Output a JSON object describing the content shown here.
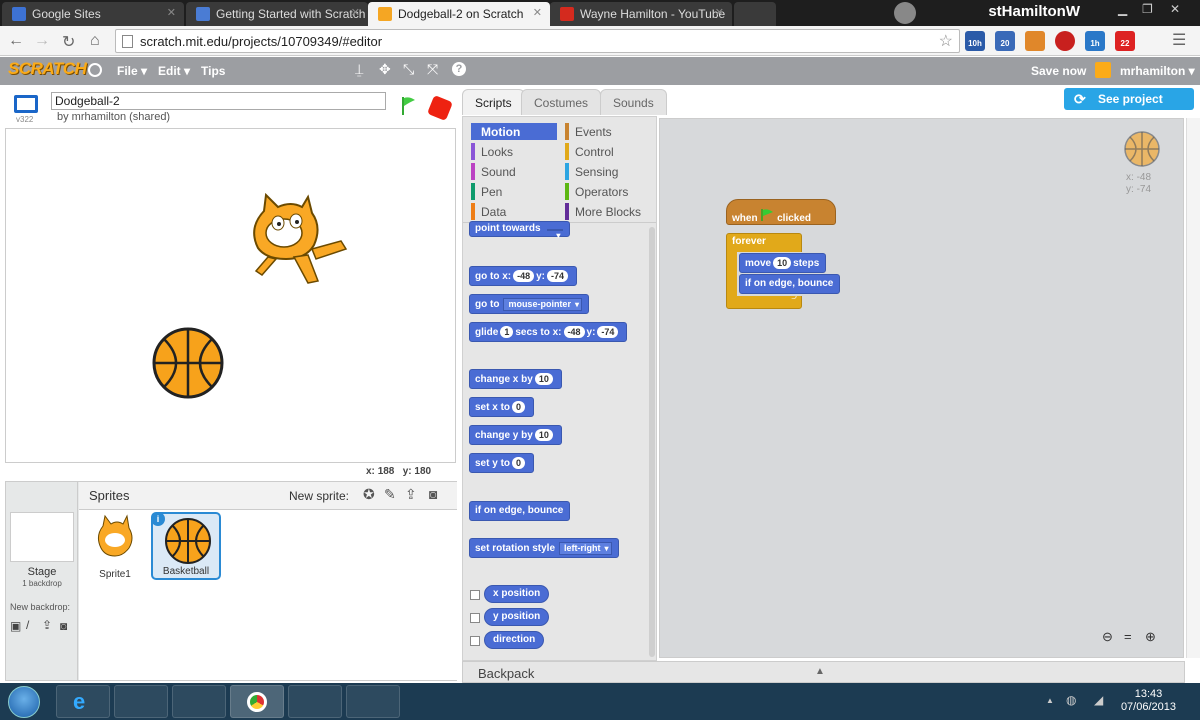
{
  "browser": {
    "tabs": [
      {
        "title": "Google Sites",
        "icon_color": "#3d72d4"
      },
      {
        "title": "Getting Started with Scratch",
        "icon_color": "#4a7cd4"
      },
      {
        "title": "Dodgeball-2 on Scratch",
        "icon_color": "#f5a623",
        "active": true
      },
      {
        "title": "Wayne Hamilton - YouTube",
        "icon_color": "#d42a1e"
      }
    ],
    "profile_name": "stHamiltonW",
    "url": "scratch.mit.edu/projects/10709349/#editor",
    "extensions": [
      "10h",
      "20",
      "",
      "",
      "1h",
      "22",
      ""
    ]
  },
  "scratch": {
    "logo": "SCRATCH",
    "menus": {
      "file": "File ▾",
      "edit": "Edit ▾",
      "tips": "Tips"
    },
    "save_now": "Save now",
    "username": "mrhamilton ▾",
    "project_title": "Dodgeball-2",
    "author": "by mrhamilton (shared)",
    "version": "v322",
    "stage_coords": {
      "x_label": "x:",
      "x": "188",
      "y_label": "y:",
      "y": "180"
    },
    "tabs": {
      "scripts": "Scripts",
      "costumes": "Costumes",
      "sounds": "Sounds"
    },
    "see_project_page": "See project page",
    "sprites_heading": "Sprites",
    "new_sprite": "New sprite:",
    "stage_label": "Stage",
    "backdrop_count": "1 backdrop",
    "new_backdrop": "New backdrop:",
    "sprites": [
      {
        "name": "Sprite1"
      },
      {
        "name": "Basketball",
        "selected": true
      }
    ],
    "categories_left": [
      {
        "label": "Motion",
        "color": "#4a6cd4"
      },
      {
        "label": "Looks",
        "color": "#8a55d7"
      },
      {
        "label": "Sound",
        "color": "#bb42c3"
      },
      {
        "label": "Pen",
        "color": "#0e9a6c"
      },
      {
        "label": "Data",
        "color": "#ee7d16"
      }
    ],
    "categories_right": [
      {
        "label": "Events",
        "color": "#c88330"
      },
      {
        "label": "Control",
        "color": "#e1a91a"
      },
      {
        "label": "Sensing",
        "color": "#2ca5e2"
      },
      {
        "label": "Operators",
        "color": "#5cb712"
      },
      {
        "label": "More Blocks",
        "color": "#632d99"
      }
    ],
    "blocks": {
      "point_towards": "point towards",
      "goto_xy": "go to x:",
      "goto_x": "-48",
      "goto_y_label": "y:",
      "goto_y": "-74",
      "goto": "go to",
      "goto_target": "mouse-pointer",
      "glide": "glide",
      "glide_secs": "1",
      "glide_mid": "secs to x:",
      "glide_x": "-48",
      "glide_y_label": "y:",
      "glide_y": "-74",
      "change_x": "change x by",
      "change_x_val": "10",
      "set_x": "set x to",
      "set_x_val": "0",
      "change_y": "change y by",
      "change_y_val": "10",
      "set_y": "set y to",
      "set_y_val": "0",
      "edge_bounce": "if on edge, bounce",
      "rotation_style": "set rotation style",
      "rotation_value": "left-right",
      "x_position": "x position",
      "y_position": "y position",
      "direction": "direction"
    },
    "script": {
      "hat_when": "when",
      "hat_clicked": "clicked",
      "forever": "forever",
      "move": "move",
      "move_val": "10",
      "move_steps": "steps",
      "bounce": "if on edge, bounce"
    },
    "sprite_info": {
      "x_label": "x:",
      "x": "-48",
      "y_label": "y:",
      "y": "-74"
    },
    "backpack": "Backpack"
  },
  "taskbar": {
    "time": "13:43",
    "date": "07/06/2013"
  }
}
